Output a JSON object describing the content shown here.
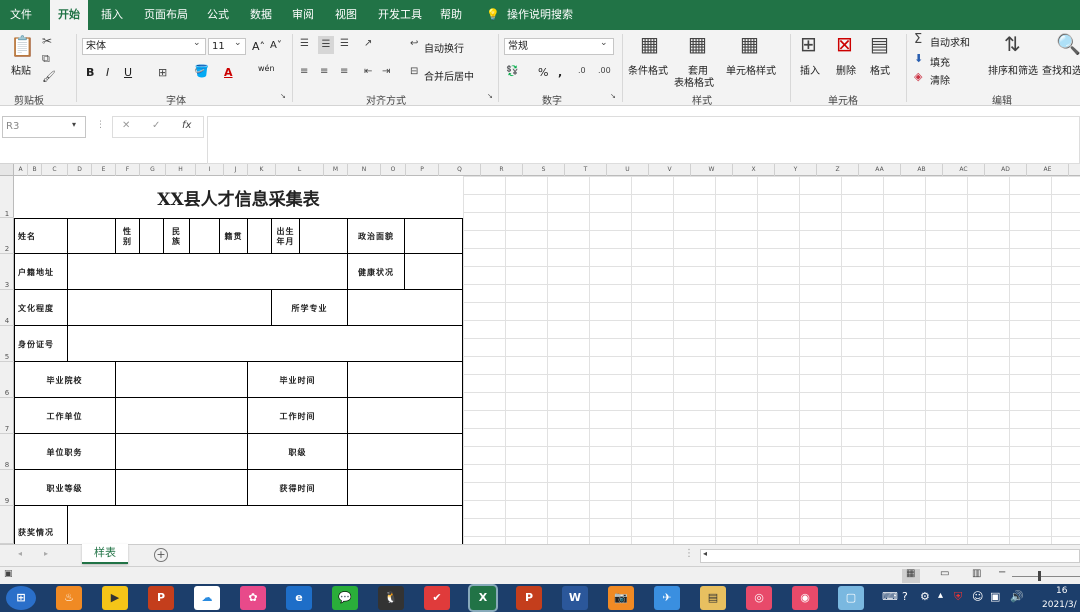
{
  "menu": {
    "items": [
      "文件",
      "开始",
      "插入",
      "页面布局",
      "公式",
      "数据",
      "审阅",
      "视图",
      "开发工具",
      "帮助",
      "操作说明搜索"
    ]
  },
  "ribbon": {
    "clipboard": {
      "paste": "粘贴",
      "group": "剪贴板"
    },
    "font": {
      "name": "宋体",
      "size": "11",
      "bold": "B",
      "italic": "I",
      "underline": "U",
      "grow": "A˄",
      "shrink": "A˅",
      "group": "字体",
      "color_a": "A",
      "wen": "wén"
    },
    "align": {
      "wrap": "自动换行",
      "merge": "合并后居中",
      "group": "对齐方式"
    },
    "number": {
      "format": "常规",
      "percent": "%",
      "comma": ",",
      "group": "数字"
    },
    "styles": {
      "cond": "条件格式",
      "table_l1": "套用",
      "table_l2": "表格格式",
      "cell": "单元格样式",
      "group": "样式"
    },
    "cells": {
      "insert": "插入",
      "delete": "删除",
      "format": "格式",
      "group": "单元格"
    },
    "edit": {
      "autosum": "自动求和",
      "fill": "填充",
      "clear": "清除",
      "sort": "排序和筛选",
      "find": "查找和选",
      "group": "编辑"
    }
  },
  "formula_bar": {
    "name_box": "R3",
    "fx": "fx",
    "cancel": "✕",
    "confirm": "✓",
    "value": ""
  },
  "columns": [
    "A",
    "B",
    "C",
    "D",
    "E",
    "F",
    "G",
    "H",
    "I",
    "J",
    "K",
    "L",
    "M",
    "N",
    "O",
    "P",
    "Q",
    "R",
    "S",
    "T",
    "U",
    "V",
    "W",
    "X",
    "Y",
    "Z",
    "AA",
    "AB",
    "AC",
    "AD",
    "AE"
  ],
  "rows": [
    "1",
    "2",
    "3",
    "4",
    "5",
    "6",
    "7",
    "8",
    "9"
  ],
  "form": {
    "title": "XX县人才信息采集表",
    "name": "姓名",
    "gender": "性\n别",
    "ethnic": "民\n族",
    "origin": "籍贯",
    "birth": "出生\n年月",
    "political": "政治面貌",
    "residence": "户籍地址",
    "health": "健康状况",
    "education": "文化程度",
    "major": "所学专业",
    "id": "身份证号",
    "school": "毕业院校",
    "grad_time": "毕业时间",
    "work_unit": "工作单位",
    "work_time": "工作时间",
    "position": "单位职务",
    "rank": "职级",
    "title_level": "职业等级",
    "obtain_time": "获得时间",
    "awards": "获奖情况"
  },
  "sheet_tabs": {
    "active": "样表",
    "add": "+"
  },
  "taskbar": {
    "clock_time": "16",
    "clock_date": "2021/3/"
  },
  "colors": {
    "excel_green": "#217346",
    "taskbar": "#1c3e6b"
  }
}
